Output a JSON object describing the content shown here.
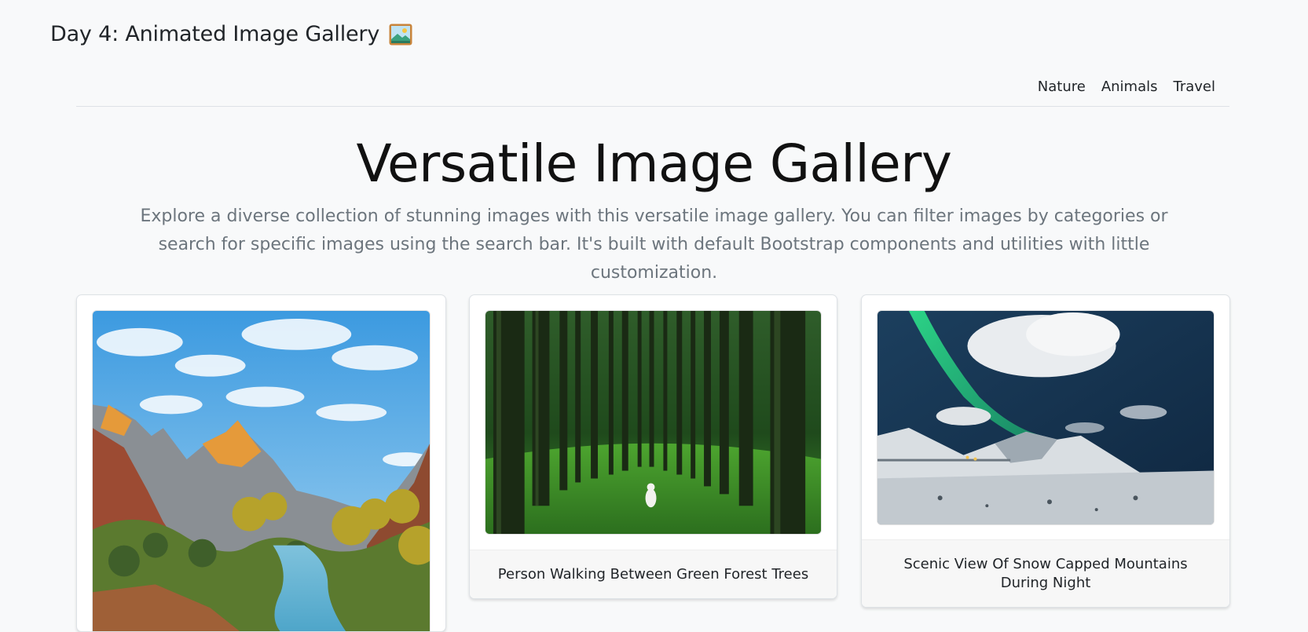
{
  "header": {
    "title": "Day 4: Animated Image Gallery",
    "title_icon": "framed-picture-icon"
  },
  "nav": {
    "items": [
      "Nature",
      "Animals",
      "Travel"
    ]
  },
  "hero": {
    "title": "Versatile Image Gallery",
    "lead": "Explore a diverse collection of stunning images with this versatile image gallery. You can filter images by categories or search for specific images using the search bar. It's built with default Bootstrap components and utilities with little customization."
  },
  "gallery": {
    "cards": [
      {
        "caption": "",
        "image": "canyon-river-landscape"
      },
      {
        "caption": "Person Walking Between Green Forest Trees",
        "image": "green-forest-trees"
      },
      {
        "caption": "Scenic View Of Snow Capped Mountains During Night",
        "image": "aurora-snow-mountains"
      }
    ]
  },
  "colors": {
    "background": "#f8f9fa",
    "text": "#212529",
    "muted": "#6c757d",
    "border": "#dee2e6"
  }
}
